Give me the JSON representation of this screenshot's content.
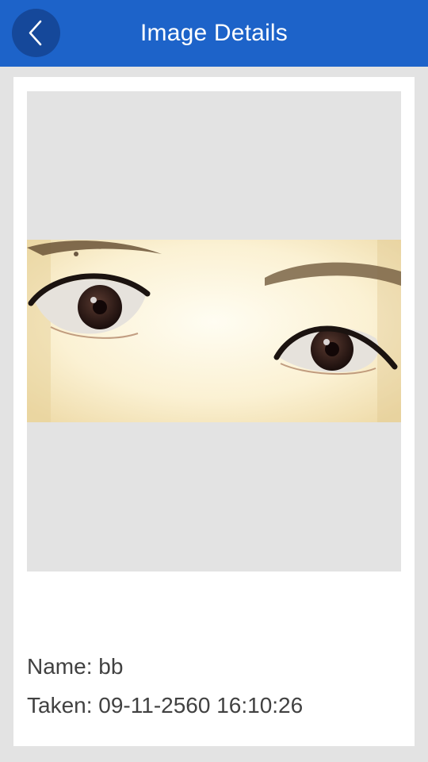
{
  "header": {
    "title": "Image Details",
    "back_icon": "chevron-left-icon",
    "accent_color": "#1d63c9"
  },
  "details": {
    "name_label": "Name:",
    "name_value": "bb",
    "taken_label": "Taken:",
    "taken_value": "09-11-2560 16:10:26"
  }
}
